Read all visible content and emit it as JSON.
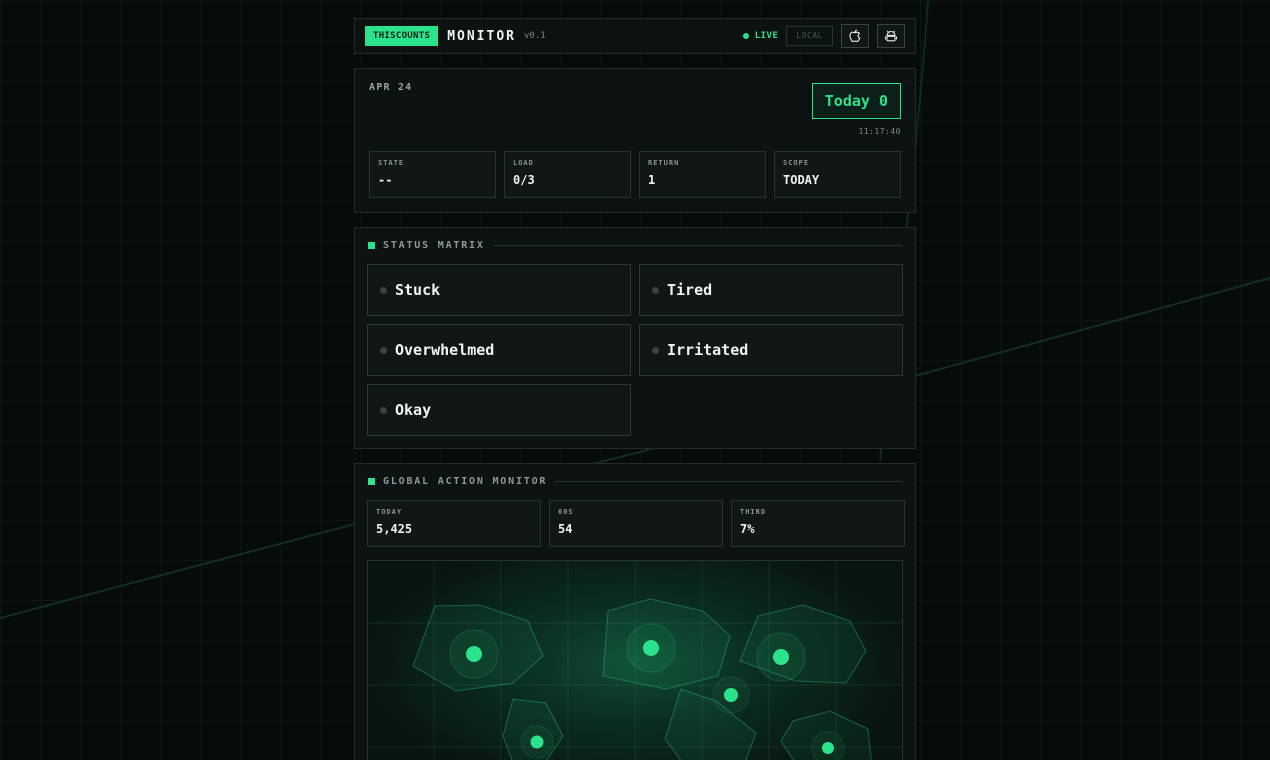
{
  "header": {
    "brand": "THISCOUNTS",
    "title": "MONITOR",
    "version": "v0.1",
    "live_label": "LIVE",
    "local_label": "LOCAL",
    "icons": [
      "apple-icon",
      "android-icon"
    ]
  },
  "today_panel": {
    "date": "APR 24",
    "today_badge": "Today 0",
    "time": "11:17:40",
    "stats": [
      {
        "label": "STATE",
        "value": "--"
      },
      {
        "label": "LOAD",
        "value": "0/3"
      },
      {
        "label": "RETURN",
        "value": "1"
      },
      {
        "label": "SCOPE",
        "value": "TODAY"
      }
    ]
  },
  "status_matrix": {
    "title": "STATUS MATRIX",
    "items": [
      "Stuck",
      "Tired",
      "Overwhelmed",
      "Irritated",
      "Okay"
    ]
  },
  "global_monitor": {
    "title": "GLOBAL ACTION MONITOR",
    "stats": [
      {
        "label": "TODAY",
        "value": "5,425"
      },
      {
        "label": "60S",
        "value": "54"
      },
      {
        "label": "THIRD",
        "value": "7%"
      }
    ]
  },
  "colors": {
    "accent": "#2be38a",
    "background": "#070b0a",
    "panel": "#0d1212",
    "border": "#242b2a"
  }
}
